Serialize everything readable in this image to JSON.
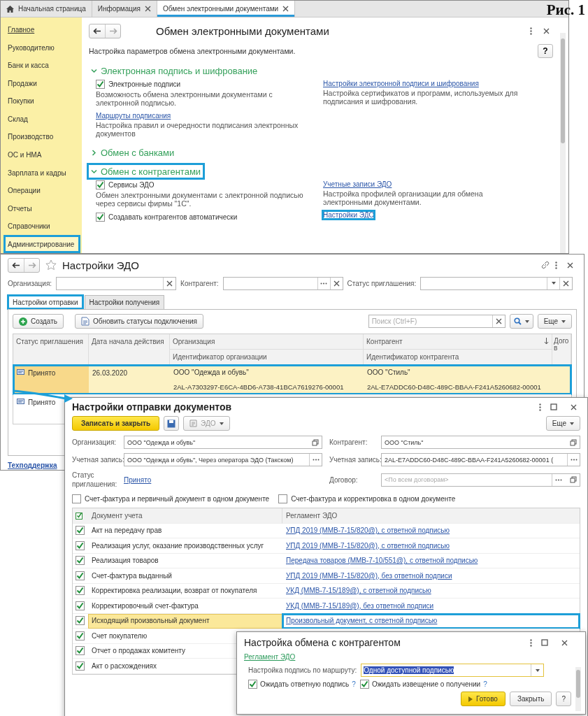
{
  "figure_label": "Рис. 1",
  "main_window": {
    "tabs": [
      {
        "label": "Начальная страница",
        "selected": false,
        "kind": "home"
      },
      {
        "label": "Информация",
        "selected": false,
        "kind": "closable"
      },
      {
        "label": "Обмен электронными документами",
        "selected": true,
        "kind": "closable"
      }
    ],
    "sidebar": {
      "items": [
        {
          "label": "Главное",
          "selected": true,
          "highlighted": false
        },
        {
          "label": "Руководителю",
          "selected": false,
          "highlighted": false
        },
        {
          "label": "Банк и касса",
          "selected": false,
          "highlighted": false
        },
        {
          "label": "Продажи",
          "selected": false,
          "highlighted": false
        },
        {
          "label": "Покупки",
          "selected": false,
          "highlighted": false
        },
        {
          "label": "Склад",
          "selected": false,
          "highlighted": false
        },
        {
          "label": "Производство",
          "selected": false,
          "highlighted": false
        },
        {
          "label": "ОС и НМА",
          "selected": false,
          "highlighted": false
        },
        {
          "label": "Зарплата и кадры",
          "selected": false,
          "highlighted": false
        },
        {
          "label": "Операции",
          "selected": false,
          "highlighted": false
        },
        {
          "label": "Отчеты",
          "selected": false,
          "highlighted": false
        },
        {
          "label": "Справочники",
          "selected": false,
          "highlighted": false
        },
        {
          "label": "Администрирование",
          "selected": false,
          "highlighted": true
        }
      ]
    },
    "title": "Обмен электронными документами",
    "description": "Настройка параметров обмена электронными документами.",
    "help_button": "?",
    "sections": [
      {
        "title": "Электронная подпись и шифрование",
        "expanded": true,
        "highlighted": false,
        "left": [
          {
            "kind": "checkbox",
            "label": "Электронные подписи",
            "checked": true,
            "description": "Возможность обмена электронными документами с электронной подписью."
          },
          {
            "kind": "link",
            "label": "Маршруты подписания",
            "description": "Настройка правил и очередности подписания электронных документов"
          }
        ],
        "right": [
          {
            "kind": "link",
            "label": "Настройки электронной подписи и шифрования",
            "description": "Настройка сертификатов и программ, используемых для подписания и шифрования.",
            "highlighted": false
          }
        ]
      },
      {
        "title": "Обмен с банками",
        "expanded": false,
        "highlighted": false
      },
      {
        "title": "Обмен с контрагентами",
        "expanded": true,
        "highlighted": true,
        "left": [
          {
            "kind": "checkbox",
            "label": "Сервисы ЭДО",
            "checked": true,
            "description": "Обмен электронными документами с электронной подписью через сервисы фирмы \"1С\"."
          },
          {
            "kind": "checkbox",
            "label": "Создавать контрагентов автоматически",
            "checked": true
          }
        ],
        "right": [
          {
            "kind": "link",
            "label": "Учетные записи ЭДО",
            "description": "Настройка профилей организации для обмена электронными документами.",
            "highlighted": false
          },
          {
            "kind": "link",
            "label": "Настройки ЭДО",
            "highlighted": true
          }
        ]
      }
    ]
  },
  "edo_window": {
    "title": "Настройки ЭДО",
    "filters": [
      {
        "label": "Организация:",
        "kind": "plain"
      },
      {
        "label": "Контрагент:",
        "kind": "choice"
      },
      {
        "label": "Статус приглашения:",
        "kind": "dropdown"
      }
    ],
    "tabs": [
      {
        "label": "Настройки отправки",
        "selected": true,
        "highlighted": true
      },
      {
        "label": "Настройки получения",
        "selected": false,
        "highlighted": false
      }
    ],
    "toolbar": {
      "create": "Создать",
      "refresh": "Обновить статусы подключения",
      "search_placeholder": "Поиск (Ctrl+F)",
      "more": "Еще"
    },
    "table": {
      "columns": [
        "Статус приглашения",
        "Дата начала действия",
        "Организация",
        "Контрагент",
        "Догов"
      ],
      "subcolumns": [
        "Идентификатор организации",
        "Идентификатор контрагента"
      ],
      "rows": [
        {
          "status": "Принято",
          "date": "26.03.2020",
          "organization": "ООО \"Одежда и обувь\"",
          "organization_id": "2AL-A7303297-E6CA-4BD6-A738-41BCA7619276-00001",
          "counterparty": "ООО \"Стиль\"",
          "counterparty_id": "2AL-E7ADDC60-D48C-489C-BBAA-F241A5260682-00001",
          "selected": true,
          "highlighted": true
        },
        {
          "status": "Принято",
          "selected": false,
          "highlighted": false
        }
      ]
    },
    "footer_link": "Техподдержка"
  },
  "send_window": {
    "title": "Настройки отправки документов",
    "toolbar": {
      "save_close": "Записать и закрыть",
      "edo": "ЭДО",
      "more": "Еще"
    },
    "left_fields": [
      {
        "label": "Организация:",
        "value": "ООО \"Одежда и обувь\"",
        "kind": "open"
      },
      {
        "label": "Учетная запись:",
        "value": "ООО \"Одежда и обувь\", Через оператора ЭДО (Такском)",
        "kind": "choice"
      },
      {
        "label": "Статус приглашения:",
        "value": "Принято",
        "kind": "link"
      }
    ],
    "right_fields": [
      {
        "label": "Контрагент:",
        "value": "ООО \"Стиль\"",
        "kind": "open"
      },
      {
        "label": "Учетная запись:",
        "value": "2AL-E7ADDC60-D48C-489C-BBAA-F241A5260682-00001 (",
        "kind": "choice"
      },
      {
        "label": "Договор:",
        "placeholder": "<По всем договорам>",
        "kind": "choice_open"
      }
    ],
    "options": [
      {
        "label": "Счет-фактура и первичный документ в одном документе",
        "checked": false
      },
      {
        "label": "Счет-фактура и корректировка в одном документе",
        "checked": false
      }
    ],
    "table": {
      "columns": [
        "Документ учета",
        "Регламент ЭДО"
      ],
      "rows": [
        {
          "checked": true,
          "document": "Акт на передачу прав",
          "regulation": "УПД 2019 (ММВ-7-15/820@), с ответной подписью",
          "highlighted": false
        },
        {
          "checked": true,
          "document": "Реализация услуг, оказание производственных услуг",
          "regulation": "УПД 2019 (ММВ-7-15/820@), с ответной подписью",
          "highlighted": false
        },
        {
          "checked": true,
          "document": "Реализация товаров",
          "regulation": "Передача товаров (ММВ-7-10/551@), с ответной подписью",
          "highlighted": false
        },
        {
          "checked": true,
          "document": "Счет-фактура выданный",
          "regulation": "УПД 2019 (ММВ-7-15/820@), без ответной подписи",
          "highlighted": false
        },
        {
          "checked": true,
          "document": "Корректировка реализации, возврат от покупателя",
          "regulation": "УКД (ММВ-7-15/189@), с ответной подписью",
          "highlighted": false
        },
        {
          "checked": true,
          "document": "Корректировочный счет-фактура",
          "regulation": "УКД (ММВ-7-15/189@), без ответной подписи",
          "highlighted": false
        },
        {
          "checked": true,
          "document": "Исходящий произвольный документ",
          "regulation": "Произвольный документ, с ответной подписью",
          "highlighted": true
        },
        {
          "checked": true,
          "document": "Счет покупателю",
          "highlighted": false
        },
        {
          "checked": true,
          "document": "Отчет о продажах комитенту",
          "highlighted": false
        },
        {
          "checked": true,
          "document": "Акт о расхождениях",
          "highlighted": false
        }
      ]
    }
  },
  "exchange_dialog": {
    "title": "Настройка обмена с контрагентом",
    "link": "Регламент ЭДО",
    "field": {
      "label": "Настройка подпись по маршруту:",
      "value": "Одной доступной подписью"
    },
    "options": [
      {
        "label": "Ожидать ответную подпись",
        "checked": true,
        "help": "?"
      },
      {
        "label": "Ожидать извещение о получении",
        "checked": true,
        "help": "?"
      }
    ],
    "buttons": [
      {
        "label": "Готово",
        "kind": "primary"
      },
      {
        "label": "Закрыть",
        "kind": "normal"
      },
      {
        "label": "?",
        "kind": "help"
      }
    ]
  }
}
